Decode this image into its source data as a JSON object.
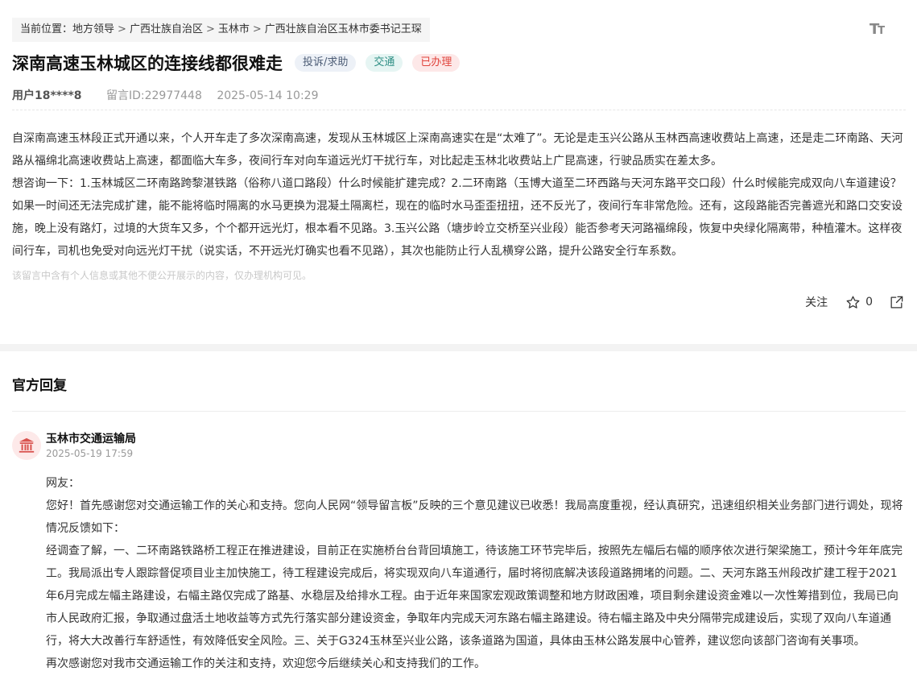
{
  "breadcrumb": {
    "prefix": "当前位置：",
    "items": [
      "地方领导",
      "广西壮族自治区",
      "玉林市",
      "广西壮族自治区玉林市委书记王琛"
    ],
    "separator": ">"
  },
  "toolbar": {
    "font_size_icon": "font-size-icon"
  },
  "post": {
    "title": "深南高速玉林城区的连接线都很难走",
    "tags": [
      "投诉/求助",
      "交通",
      "已办理"
    ],
    "user": "用户18****8",
    "message_id": "留言ID:22977448",
    "datetime": "2025-05-14 10:29",
    "paragraphs": [
      "自深南高速玉林段正式开通以来，个人开车走了多次深南高速，发现从玉林城区上深南高速实在是“太难了”。无论是走玉兴公路从玉林西高速收费站上高速，还是走二环南路、天河路从福绵北高速收费站上高速，都面临大车多，夜间行车对向车道远光灯干扰行车，对比起走玉林北收费站上广昆高速，行驶品质实在差太多。",
      "想咨询一下：1.玉林城区二环南路跨黎湛铁路（俗称八道口路段）什么时候能扩建完成？2.二环南路（玉博大道至二环西路与天河东路平交口段）什么时候能完成双向八车道建设？如果一时间还无法完成扩建，能不能将临时隔离的水马更换为混凝土隔离栏，现在的临时水马歪歪扭扭，还不反光了，夜间行车非常危险。还有，这段路能否完善遮光和路口交安设施，晚上没有路灯，过境的大货车又多，个个都开远光灯，根本看不见路。3.玉兴公路（塘步岭立交桥至兴业段）能否参考天河路福绵段，恢复中央绿化隔离带，种植灌木。这样夜间行车，司机也免受对向远光灯干扰（说实话，不开远光灯确实也看不见路），其次也能防止行人乱横穿公路，提升公路安全行车系数。"
    ],
    "privacy_notice": "该留言中含有个人信息或其他不便公开展示的内容，仅办理机构可见。"
  },
  "actions": {
    "follow_label": "关注",
    "like_count": "0"
  },
  "reply": {
    "section_title": "官方回复",
    "org_name": "玉林市交通运输局",
    "datetime": "2025-05-19 17:59",
    "paragraphs": [
      "网友：",
      "您好！首先感谢您对交通运输工作的关心和支持。您向人民网“领导留言板”反映的三个意见建议已收悉！我局高度重视，经认真研究，迅速组织相关业务部门进行调处，现将情况反馈如下：",
      "经调查了解，一、二环南路铁路桥工程正在推进建设，目前正在实施桥台台背回填施工，待该施工环节完毕后，按照先左幅后右幅的顺序依次进行架梁施工，预计今年年底完工。我局派出专人跟踪督促项目业主加快施工，待工程建设完成后，将实现双向八车道通行，届时将彻底解决该段道路拥堵的问题。二、天河东路玉州段改扩建工程于2021年6月完成左幅主路建设，右幅主路仅完成了路基、水稳层及给排水工程。由于近年来国家宏观政策调整和地方财政困难，项目剩余建设资金难以一次性筹措到位，我局已向市人民政府汇报，争取通过盘活土地收益等方式先行落实部分建设资金，争取年内完成天河东路右幅主路建设。待右幅主路及中央分隔带完成建设后，实现了双向八车道通行，将大大改善行车舒适性，有效降低安全风险。三、关于G324玉林至兴业公路，该条道路为国道，具体由玉林公路发展中心管养，建议您向该部门咨询有关事项。",
      "再次感谢您对我市交通运输工作的关注和支持，欢迎您今后继续关心和支持我们的工作。"
    ]
  },
  "colors": {
    "tag_complaint": "#4d5d76",
    "tag_traffic": "#2f8f85",
    "tag_done": "#e0433b",
    "avatar_icon": "#d9534f"
  }
}
